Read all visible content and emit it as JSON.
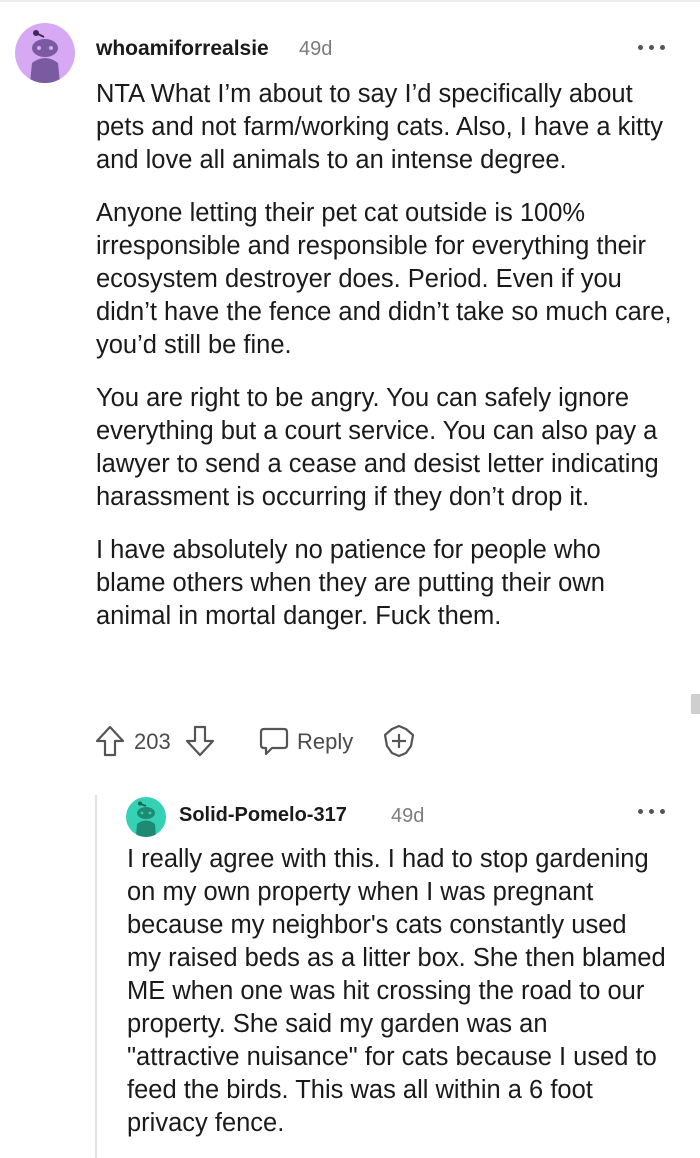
{
  "comment": {
    "author": "whoamiforrealsie",
    "age": "49d",
    "paragraphs": [
      "NTA What I’m about to say I’d specifically about pets and not farm/working cats. Also, I have a kitty and love all animals to an intense degree.",
      "Anyone letting their pet cat outside is 100% irresponsible and responsible for everything their ecosystem destroyer does. Period. Even if you didn’t have the fence and didn’t take so much care, you’d still be fine.",
      "You are right to be angry. You can safely ignore everything but a court service. You can also pay a lawyer to send a cease and desist letter indicating harassment is occurring if they don’t drop it.",
      "I have absolutely no patience for people who blame others when they are putting their own animal in mortal danger. Fuck them."
    ],
    "score": "203",
    "reply_label": "Reply",
    "avatar_color": "#d7a9f5",
    "icons": {
      "more": "more-options-icon",
      "upvote": "upvote-arrow-icon",
      "downvote": "downvote-arrow-icon",
      "reply": "speech-bubble-icon",
      "award": "award-plus-icon"
    }
  },
  "reply": {
    "author": "Solid-Pomelo-317",
    "age": "49d",
    "text": "I really agree with this. I had to stop gardening on my own property when I was pregnant because my neighbor's cats constantly used my raised beds as a litter box. She then blamed ME when one was hit crossing the road to our property. She said my garden was an \"attractive nuisance\" for cats because I used to feed the birds. This was all within a 6 foot privacy fence.",
    "avatar_color": "#34d1b4"
  }
}
